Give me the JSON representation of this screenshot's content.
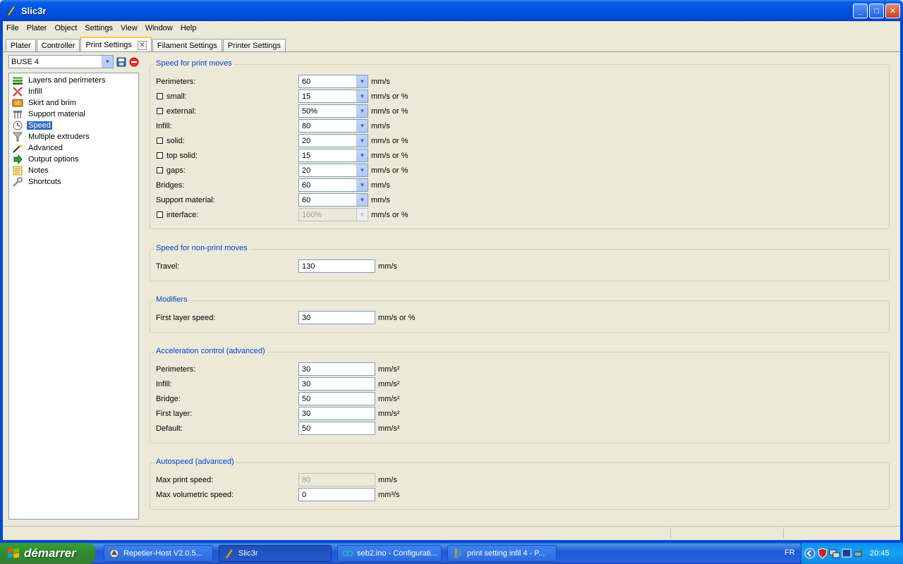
{
  "window": {
    "title": "Slic3r"
  },
  "menu": [
    "File",
    "Plater",
    "Object",
    "Settings",
    "View",
    "Window",
    "Help"
  ],
  "tabs": [
    {
      "label": "Plater"
    },
    {
      "label": "Controller"
    },
    {
      "label": "Print Settings",
      "active": true
    },
    {
      "label": "Filament Settings"
    },
    {
      "label": "Printer Settings"
    }
  ],
  "preset": {
    "value": "BUSE 4"
  },
  "tree": [
    {
      "label": "Layers and perimeters",
      "icon": "layers-icon"
    },
    {
      "label": "Infill",
      "icon": "infill-icon"
    },
    {
      "label": "Skirt and brim",
      "icon": "skirt-icon"
    },
    {
      "label": "Support material",
      "icon": "support-icon"
    },
    {
      "label": "Speed",
      "icon": "clock-icon",
      "selected": true
    },
    {
      "label": "Multiple extruders",
      "icon": "funnel-icon"
    },
    {
      "label": "Advanced",
      "icon": "wand-icon"
    },
    {
      "label": "Output options",
      "icon": "output-icon"
    },
    {
      "label": "Notes",
      "icon": "notes-icon"
    },
    {
      "label": "Shortcuts",
      "icon": "wrench-icon"
    }
  ],
  "groups": {
    "print_moves": {
      "title": "Speed for print moves",
      "rows": [
        {
          "label": "Perimeters:",
          "value": "60",
          "unit": "mm/s"
        },
        {
          "label": "small:",
          "value": "15",
          "unit": "mm/s or %"
        },
        {
          "label": "external:",
          "value": "50%",
          "unit": "mm/s or %"
        },
        {
          "label": "Infill:",
          "value": "80",
          "unit": "mm/s"
        },
        {
          "label": "solid:",
          "value": "20",
          "unit": "mm/s or %"
        },
        {
          "label": "top solid:",
          "value": "15",
          "unit": "mm/s or %"
        },
        {
          "label": "gaps:",
          "value": "20",
          "unit": "mm/s or %"
        },
        {
          "label": "Bridges:",
          "value": "60",
          "unit": "mm/s"
        },
        {
          "label": "Support material:",
          "value": "60",
          "unit": "mm/s"
        },
        {
          "label": "interface:",
          "value": "100%",
          "unit": "mm/s or %"
        }
      ]
    },
    "non_print": {
      "title": "Speed for non-print moves",
      "rows": [
        {
          "label": "Travel:",
          "value": "130",
          "unit": "mm/s"
        }
      ]
    },
    "modifiers": {
      "title": "Modifiers",
      "rows": [
        {
          "label": "First layer speed:",
          "value": "30",
          "unit": "mm/s or %"
        }
      ]
    },
    "acceleration": {
      "title": "Acceleration control (advanced)",
      "rows": [
        {
          "label": "Perimeters:",
          "value": "30",
          "unit": "mm/s²"
        },
        {
          "label": "Infill:",
          "value": "30",
          "unit": "mm/s²"
        },
        {
          "label": "Bridge:",
          "value": "50",
          "unit": "mm/s²"
        },
        {
          "label": "First layer:",
          "value": "30",
          "unit": "mm/s²"
        },
        {
          "label": "Default:",
          "value": "50",
          "unit": "mm/s²"
        }
      ]
    },
    "autospeed": {
      "title": "Autospeed (advanced)",
      "rows": [
        {
          "label": "Max print speed:",
          "value": "80",
          "unit": "mm/s"
        },
        {
          "label": "Max volumetric speed:",
          "value": "0",
          "unit": "mm³/s"
        }
      ]
    }
  },
  "taskbar": {
    "start_label": "démarrer",
    "tasks": [
      {
        "label": "Repetier-Host V2.0.5...",
        "icon": "repetier-icon"
      },
      {
        "label": "Slic3r",
        "icon": "slic3r-icon",
        "active": true
      },
      {
        "label": "seb2.ino - Configurati...",
        "icon": "arduino-icon"
      },
      {
        "label": "print setting infil 4 - P...",
        "icon": "paint-icon"
      }
    ],
    "language": "FR",
    "clock": "20:45"
  }
}
